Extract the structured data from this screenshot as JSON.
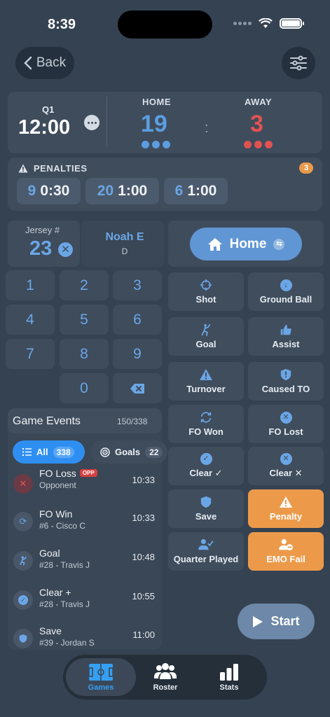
{
  "status": {
    "time": "8:39"
  },
  "nav": {
    "back_label": "Back"
  },
  "score": {
    "quarter": "Q1",
    "clock": "12:00",
    "home_label": "HOME",
    "away_label": "AWAY",
    "home_score": "19",
    "away_score": "3",
    "separator": ":",
    "home_color": "#5b9de0",
    "away_color": "#e05252",
    "home_timeouts": 3,
    "away_timeouts": 3
  },
  "penalties": {
    "title": "PENALTIES",
    "count": "3",
    "items": [
      {
        "number": "9",
        "time": "0:30"
      },
      {
        "number": "20",
        "time": "1:00"
      },
      {
        "number": "6",
        "time": "1:00"
      }
    ]
  },
  "entry": {
    "jersey_label": "Jersey #",
    "jersey_value": "23",
    "player_name": "Noah E",
    "player_position": "D",
    "keys": [
      "1",
      "2",
      "3",
      "4",
      "5",
      "6",
      "7",
      "8",
      "9",
      "0"
    ],
    "team_toggle": "Home"
  },
  "actions": [
    {
      "label": "Shot",
      "icon": "crosshair-icon"
    },
    {
      "label": "Ground Ball",
      "icon": "arrow-down-circle-icon"
    },
    {
      "label": "Goal",
      "icon": "player-shooting-icon"
    },
    {
      "label": "Assist",
      "icon": "thumbs-up-icon"
    },
    {
      "label": "Turnover",
      "icon": "warning-triangle-icon"
    },
    {
      "label": "Caused TO",
      "icon": "shield-exclamation-icon"
    },
    {
      "label": "FO Won",
      "icon": "cycle-arrows-icon"
    },
    {
      "label": "FO Lost",
      "icon": "x-circle-icon"
    },
    {
      "label": "Clear ✓",
      "icon": "check-circle-icon"
    },
    {
      "label": "Clear ✕",
      "icon": "x-circle-icon"
    },
    {
      "label": "Save",
      "icon": "shield-icon"
    },
    {
      "label": "Penalty",
      "icon": "warning-triangle-icon"
    },
    {
      "label": "Quarter Played",
      "icon": "person-check-icon"
    },
    {
      "label": "EMO Fail",
      "icon": "person-minus-icon"
    }
  ],
  "events": {
    "title": "Game Events",
    "count": "150/338",
    "filters": [
      {
        "label": "All",
        "count": "338"
      },
      {
        "label": "Goals",
        "count": "22"
      }
    ],
    "opp_badge": "OPP",
    "items": [
      {
        "name": "FO Loss",
        "sub": "Opponent",
        "time": "10:33",
        "icon": "x-circle-icon"
      },
      {
        "name": "FO Win",
        "sub": "#6 - Cisco C",
        "time": "10:33",
        "icon": "cycle-arrows-icon"
      },
      {
        "name": "Goal",
        "sub": "#28 - Travis J",
        "time": "10:48",
        "icon": "player-shooting-icon"
      },
      {
        "name": "Clear +",
        "sub": "#28 - Travis J",
        "time": "10:55",
        "icon": "check-circle-icon"
      },
      {
        "name": "Save",
        "sub": "#39 - Jordan S",
        "time": "11:00",
        "icon": "shield-icon"
      }
    ]
  },
  "start_label": "Start",
  "tabs": [
    {
      "label": "Games"
    },
    {
      "label": "Roster"
    },
    {
      "label": "Stats"
    }
  ]
}
